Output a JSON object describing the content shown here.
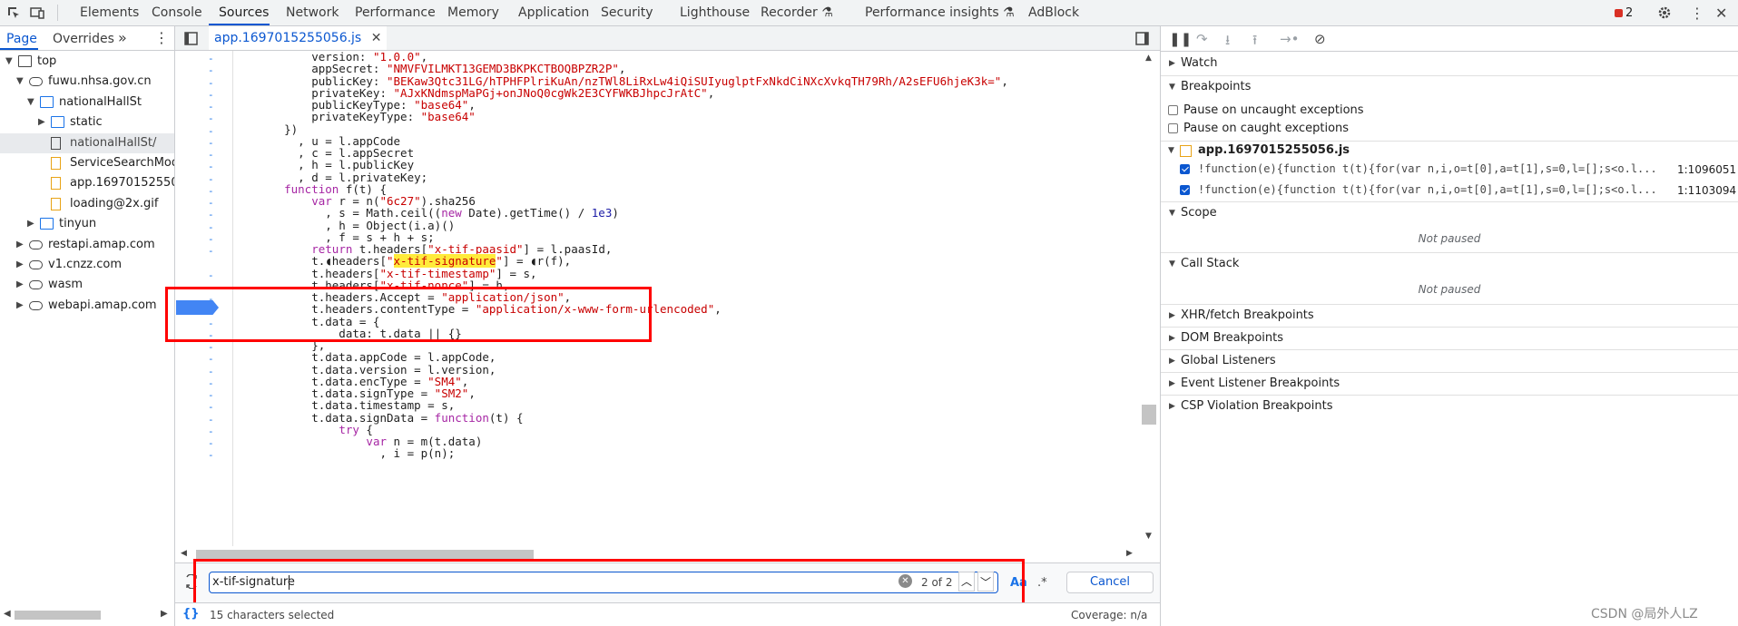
{
  "toolbar": {
    "tabs": [
      "Elements",
      "Console",
      "Sources",
      "Network",
      "Performance",
      "Memory",
      "Application",
      "Security",
      "Lighthouse",
      "Recorder",
      "Performance insights",
      "AdBlock"
    ],
    "active_tab": "Sources",
    "error_count": "2"
  },
  "navigator": {
    "tabs": [
      "Page",
      "Overrides"
    ],
    "more": "»",
    "tree": [
      {
        "label": "top",
        "icon": "frame-icon"
      },
      {
        "label": "fuwu.nhsa.gov.cn",
        "icon": "cloud-icon"
      },
      {
        "label": "nationalHallSt",
        "icon": "folder-icon"
      },
      {
        "label": "static",
        "icon": "folder-icon"
      },
      {
        "label": "nationalHallSt/",
        "icon": "file-icon"
      },
      {
        "label": "ServiceSearchMod",
        "icon": "js-file-icon"
      },
      {
        "label": "app.169701525505",
        "icon": "js-file-icon"
      },
      {
        "label": "loading@2x.gif",
        "icon": "js-file-icon"
      },
      {
        "label": "tinyun",
        "icon": "folder-icon"
      },
      {
        "label": "restapi.amap.com",
        "icon": "cloud-icon"
      },
      {
        "label": "v1.cnzz.com",
        "icon": "cloud-icon"
      },
      {
        "label": "wasm",
        "icon": "cloud-icon"
      },
      {
        "label": "webapi.amap.com",
        "icon": "cloud-icon"
      }
    ]
  },
  "editor": {
    "file_tab": "app.1697015255056.js",
    "lines": [
      [
        [
          "t",
          "        version: "
        ],
        [
          "s",
          "\"1.0.0\""
        ],
        [
          "t",
          ","
        ]
      ],
      [
        [
          "t",
          "        appSecret: "
        ],
        [
          "s",
          "\"NMVFVILMKT13GEMD3BKPKCTBOQBPZR2P\""
        ],
        [
          "t",
          ","
        ]
      ],
      [
        [
          "t",
          "        publicKey: "
        ],
        [
          "s",
          "\"BEKaw3Qtc31LG/hTPHFPlriKuAn/nzTWl8LiRxLw4iQiSUIyuglptFxNkdCiNXcXvkqTH79Rh/A2sEFU6hjeK3k=\""
        ],
        [
          "t",
          ","
        ]
      ],
      [
        [
          "t",
          "        privateKey: "
        ],
        [
          "s",
          "\"AJxKNdmspMaPGj+onJNoQ0cgWk2E3CYFWKBJhpcJrAtC\""
        ],
        [
          "t",
          ","
        ]
      ],
      [
        [
          "t",
          "        publicKeyType: "
        ],
        [
          "s",
          "\"base64\""
        ],
        [
          "t",
          ","
        ]
      ],
      [
        [
          "t",
          "        privateKeyType: "
        ],
        [
          "s",
          "\"base64\""
        ]
      ],
      [
        [
          "t",
          "    })"
        ]
      ],
      [
        [
          "t",
          "      , u = l.appCode"
        ]
      ],
      [
        [
          "t",
          "      , c = l.appSecret"
        ]
      ],
      [
        [
          "t",
          "      , h = l.publicKey"
        ]
      ],
      [
        [
          "t",
          "      , d = l.privateKey;"
        ]
      ],
      [
        [
          "t",
          "    "
        ],
        [
          "k",
          "function"
        ],
        [
          "t",
          " f(t) {"
        ]
      ],
      [
        [
          "t",
          "        "
        ],
        [
          "k",
          "var"
        ],
        [
          "t",
          " r = n("
        ],
        [
          "s",
          "\"6c27\""
        ],
        [
          "t",
          ").sha256"
        ]
      ],
      [
        [
          "t",
          "          , s = Math.ceil(("
        ],
        [
          "k",
          "new"
        ],
        [
          "t",
          " Date).getTime() / "
        ],
        [
          "n",
          "1e3"
        ],
        [
          "t",
          ")"
        ]
      ],
      [
        [
          "t",
          "          , h = Object(i.a)()"
        ]
      ],
      [
        [
          "t",
          "          , f = s + h + s;"
        ]
      ],
      [
        [
          "t",
          "        "
        ],
        [
          "k",
          "return"
        ],
        [
          "t",
          " t.headers["
        ],
        [
          "s",
          "\"x-tif-paasid\""
        ],
        [
          "t",
          "] = l.paasId,"
        ]
      ],
      [
        [
          "t",
          "        t.◖headers["
        ],
        [
          "s",
          "\""
        ],
        [
          "h",
          "x-tif-signature"
        ],
        [
          "s",
          "\""
        ],
        [
          "t",
          "] = ◖r(f),"
        ]
      ],
      [
        [
          "t",
          "        t.headers["
        ],
        [
          "s",
          "\"x-tif-timestamp\""
        ],
        [
          "t",
          "] = s,"
        ]
      ],
      [
        [
          "t",
          "        t.headers["
        ],
        [
          "s",
          "\"x-tif-nonce\""
        ],
        [
          "t",
          "] = h,"
        ]
      ],
      [
        [
          "t",
          "        t.headers.Accept = "
        ],
        [
          "s",
          "\"application/json\""
        ],
        [
          "t",
          ","
        ]
      ],
      [
        [
          "t",
          "        t.headers.contentType = "
        ],
        [
          "s",
          "\"application/x-www-form-urlencoded\""
        ],
        [
          "t",
          ","
        ]
      ],
      [
        [
          "t",
          "        t.data = {"
        ]
      ],
      [
        [
          "t",
          "            data: t.data || {}"
        ]
      ],
      [
        [
          "t",
          "        },"
        ]
      ],
      [
        [
          "t",
          "        t.data.appCode = l.appCode,"
        ]
      ],
      [
        [
          "t",
          "        t.data.version = l.version,"
        ]
      ],
      [
        [
          "t",
          "        t.data.encType = "
        ],
        [
          "s",
          "\"SM4\""
        ],
        [
          "t",
          ","
        ]
      ],
      [
        [
          "t",
          "        t.data.signType = "
        ],
        [
          "s",
          "\"SM2\""
        ],
        [
          "t",
          ","
        ]
      ],
      [
        [
          "t",
          "        t.data.timestamp = s,"
        ]
      ],
      [
        [
          "t",
          "        t.data.signData = "
        ],
        [
          "k",
          "function"
        ],
        [
          "t",
          "(t) {"
        ]
      ],
      [
        [
          "t",
          "            "
        ],
        [
          "k",
          "try"
        ],
        [
          "t",
          " {"
        ]
      ],
      [
        [
          "t",
          "                "
        ],
        [
          "k",
          "var"
        ],
        [
          "t",
          " n = m(t.data)"
        ]
      ],
      [
        [
          "t",
          "                  , i = p(n);"
        ]
      ]
    ]
  },
  "search": {
    "query": "x-tif-signature",
    "match_count": "2 of 2",
    "case_label": "Aa",
    "regex_label": ".*",
    "cancel_label": "Cancel"
  },
  "status": {
    "selection": "15 characters selected",
    "coverage": "Coverage: n/a"
  },
  "debugger": {
    "watch": "Watch",
    "breakpoints": "Breakpoints",
    "pause_uncaught": "Pause on uncaught exceptions",
    "pause_caught": "Pause on caught exceptions",
    "bp_file": "app.1697015255056.js",
    "bp_items": [
      {
        "code": "!function(e){function t(t){for(var n,i,o=t[0],a=t[1],s=0,l=[];s<o.l...",
        "loc": "1:1096051"
      },
      {
        "code": "!function(e){function t(t){for(var n,i,o=t[0],a=t[1],s=0,l=[];s<o.l...",
        "loc": "1:1103094"
      }
    ],
    "scope": "Scope",
    "not_paused_1": "Not paused",
    "call_stack": "Call Stack",
    "not_paused_2": "Not paused",
    "sections": [
      "XHR/fetch Breakpoints",
      "DOM Breakpoints",
      "Global Listeners",
      "Event Listener Breakpoints",
      "CSP Violation Breakpoints"
    ]
  },
  "watermark": "CSDN @局外人LZ"
}
